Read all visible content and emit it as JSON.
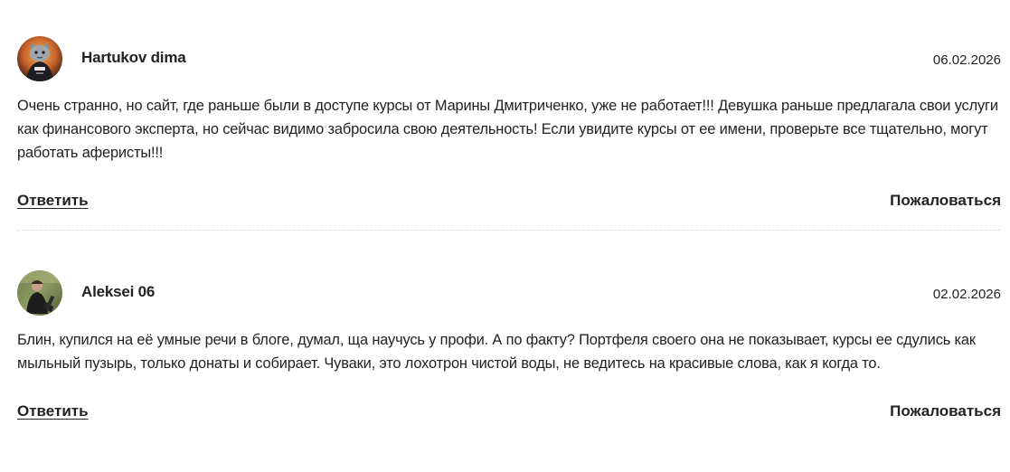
{
  "comments": [
    {
      "author": "Hartukov dima",
      "date": "06.02.2026",
      "avatar_icon": "cat-avatar-icon",
      "text": "Очень странно, но сайт, где раньше были в доступе курсы от Марины Дмитриченко, уже не работает!!! Девушка раньше предлагала свои услуги как финансового эксперта, но сейчас видимо забросила свою деятельность! Если увидите курсы от ее имени, проверьте все тщательно, могут работать аферисты!!!",
      "reply_label": "Ответить",
      "report_label": "Пожаловаться"
    },
    {
      "author": "Aleksei 06",
      "date": "02.02.2026",
      "avatar_icon": "person-avatar-icon",
      "text": "Блин, купился на её умные речи в блоге, думал, ща научусь у профи. А по факту? Портфеля своего она не показывает, курсы ее сдулись как мыльный пузырь, только донаты и собирает. Чуваки, это лохотрон чистой воды, не ведитесь на красивые слова, как я когда то.",
      "reply_label": "Ответить",
      "report_label": "Пожаловаться"
    }
  ]
}
